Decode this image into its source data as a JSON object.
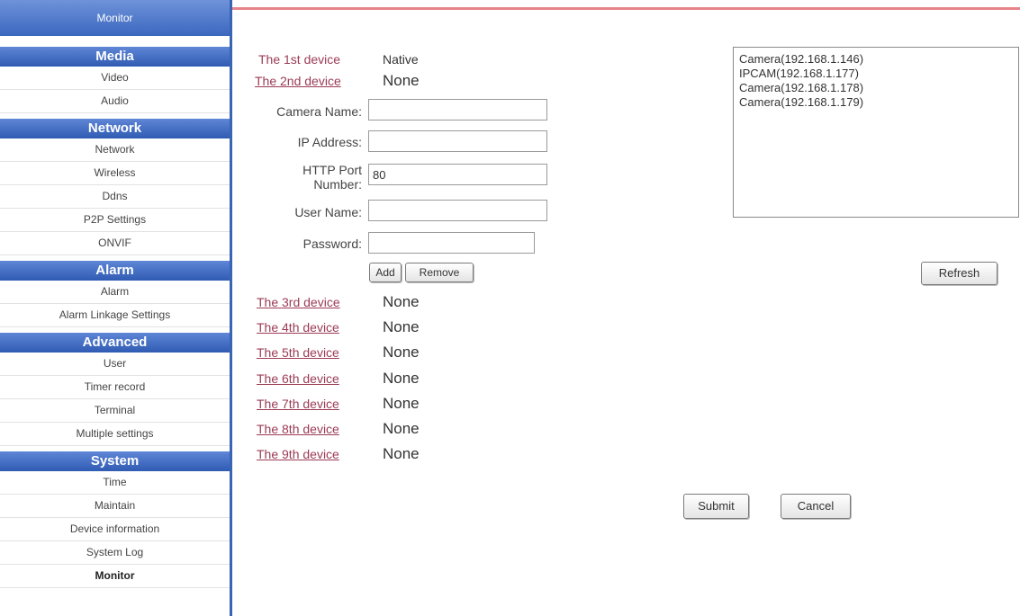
{
  "sidebar": {
    "top_tab": "Monitor",
    "sections": [
      {
        "title": "Media",
        "items": [
          "Video",
          "Audio"
        ]
      },
      {
        "title": "Network",
        "items": [
          "Network",
          "Wireless",
          "Ddns",
          "P2P Settings",
          "ONVIF"
        ]
      },
      {
        "title": "Alarm",
        "items": [
          "Alarm",
          "Alarm Linkage Settings"
        ]
      },
      {
        "title": "Advanced",
        "items": [
          "User",
          "Timer record",
          "Terminal",
          "Multiple settings"
        ]
      },
      {
        "title": "System",
        "items": [
          "Time",
          "Maintain",
          "Device information",
          "System Log",
          "Monitor"
        ]
      }
    ],
    "active_item": "Monitor"
  },
  "form": {
    "dev1_label": "The 1st device",
    "dev1_value": "Native",
    "dev2_label": "The 2nd device",
    "dev2_value": "None",
    "camera_name_label": "Camera Name:",
    "camera_name_value": "",
    "ip_label": "IP Address:",
    "ip_value": "",
    "http_port_label_1": "HTTP Port",
    "http_port_label_2": "Number:",
    "http_port_value": "80",
    "user_label": "User Name:",
    "user_value": "",
    "password_label": "Password:",
    "password_value": "",
    "add_button": "Add",
    "remove_button": "Remove",
    "devices": [
      {
        "label": "The 3rd device",
        "value": "None"
      },
      {
        "label": "The 4th device",
        "value": "None"
      },
      {
        "label": "The 5th device",
        "value": "None"
      },
      {
        "label": "The 6th device",
        "value": "None"
      },
      {
        "label": "The 7th device",
        "value": "None"
      },
      {
        "label": "The 8th device",
        "value": "None"
      },
      {
        "label": "The 9th device",
        "value": "None"
      }
    ]
  },
  "camera_list": {
    "items": [
      "Camera(192.168.1.146)",
      "IPCAM(192.168.1.177)",
      "Camera(192.168.1.178)",
      "Camera(192.168.1.179)"
    ],
    "refresh_button": "Refresh"
  },
  "actions": {
    "submit": "Submit",
    "cancel": "Cancel"
  },
  "colors": {
    "sidebar_header": "#3b67bf",
    "device_label": "#9b3b55",
    "top_line": "#e6848a"
  }
}
